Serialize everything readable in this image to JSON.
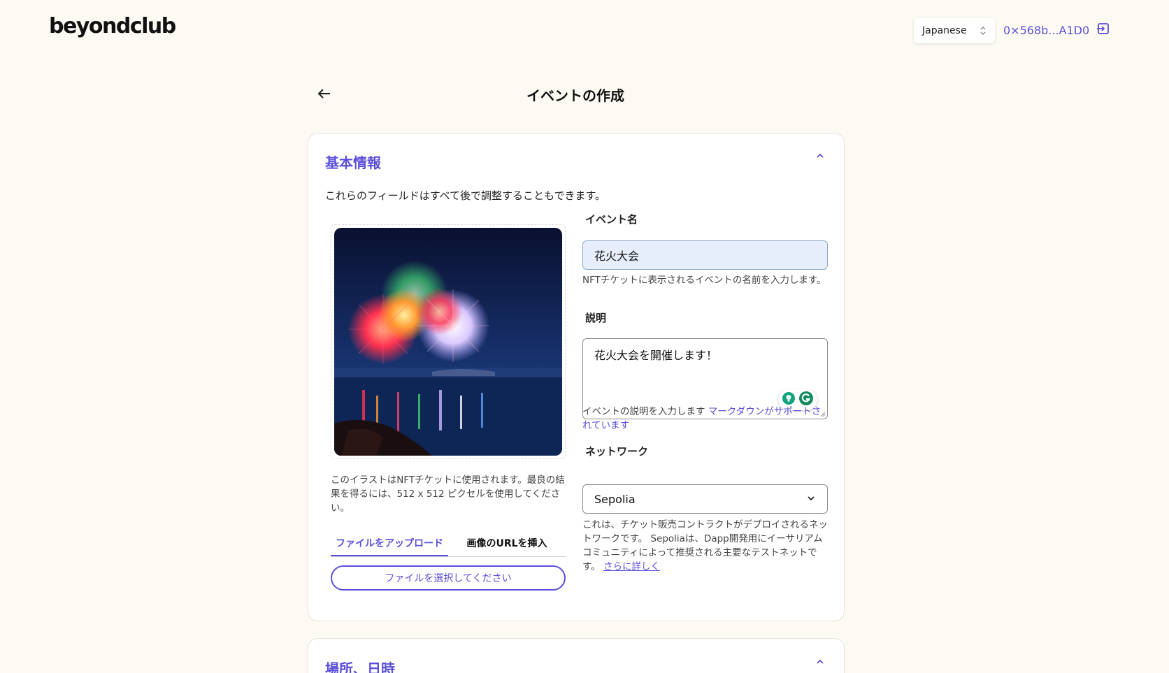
{
  "header": {
    "logo": "beyondclub",
    "language": "Japanese",
    "wallet_address": "0×568b...A1D0"
  },
  "page": {
    "title": "イベントの作成"
  },
  "basic_info": {
    "title": "基本情報",
    "intro": "これらのフィールドはすべて後で調整することもできます。",
    "image_caption": "このイラストはNFTチケットに使用されます。最良の結果を得るには、512 x 512 ピクセルを使用してください。",
    "tabs": [
      {
        "label": "ファイルをアップロード",
        "active": true
      },
      {
        "label": "画像のURLを挿入",
        "active": false
      }
    ],
    "file_button": "ファイルを選択してください",
    "event_name": {
      "label": "イベント名",
      "value": "花火大会",
      "help": "NFTチケットに表示されるイベントの名前を入力します。"
    },
    "description": {
      "label": "説明",
      "value": "花火大会を開催します！",
      "help": "イベントの説明を入力します",
      "help_link": "マークダウンがサポートされています"
    },
    "network": {
      "label": "ネットワーク",
      "value": "Sepolia",
      "help": "これは、チケット販売コントラクトがデプロイされるネットワークです。 Sepoliaは、Dapp開発用にイーサリアムコミュニティによって推奨される主要なテストネットです。",
      "help_link": "さらに詳しく"
    }
  },
  "location_section": {
    "title": "場所、日時"
  },
  "colors": {
    "accent": "#5b4fd9",
    "background": "#fdfaf3",
    "input_fill": "#e6eefb"
  }
}
